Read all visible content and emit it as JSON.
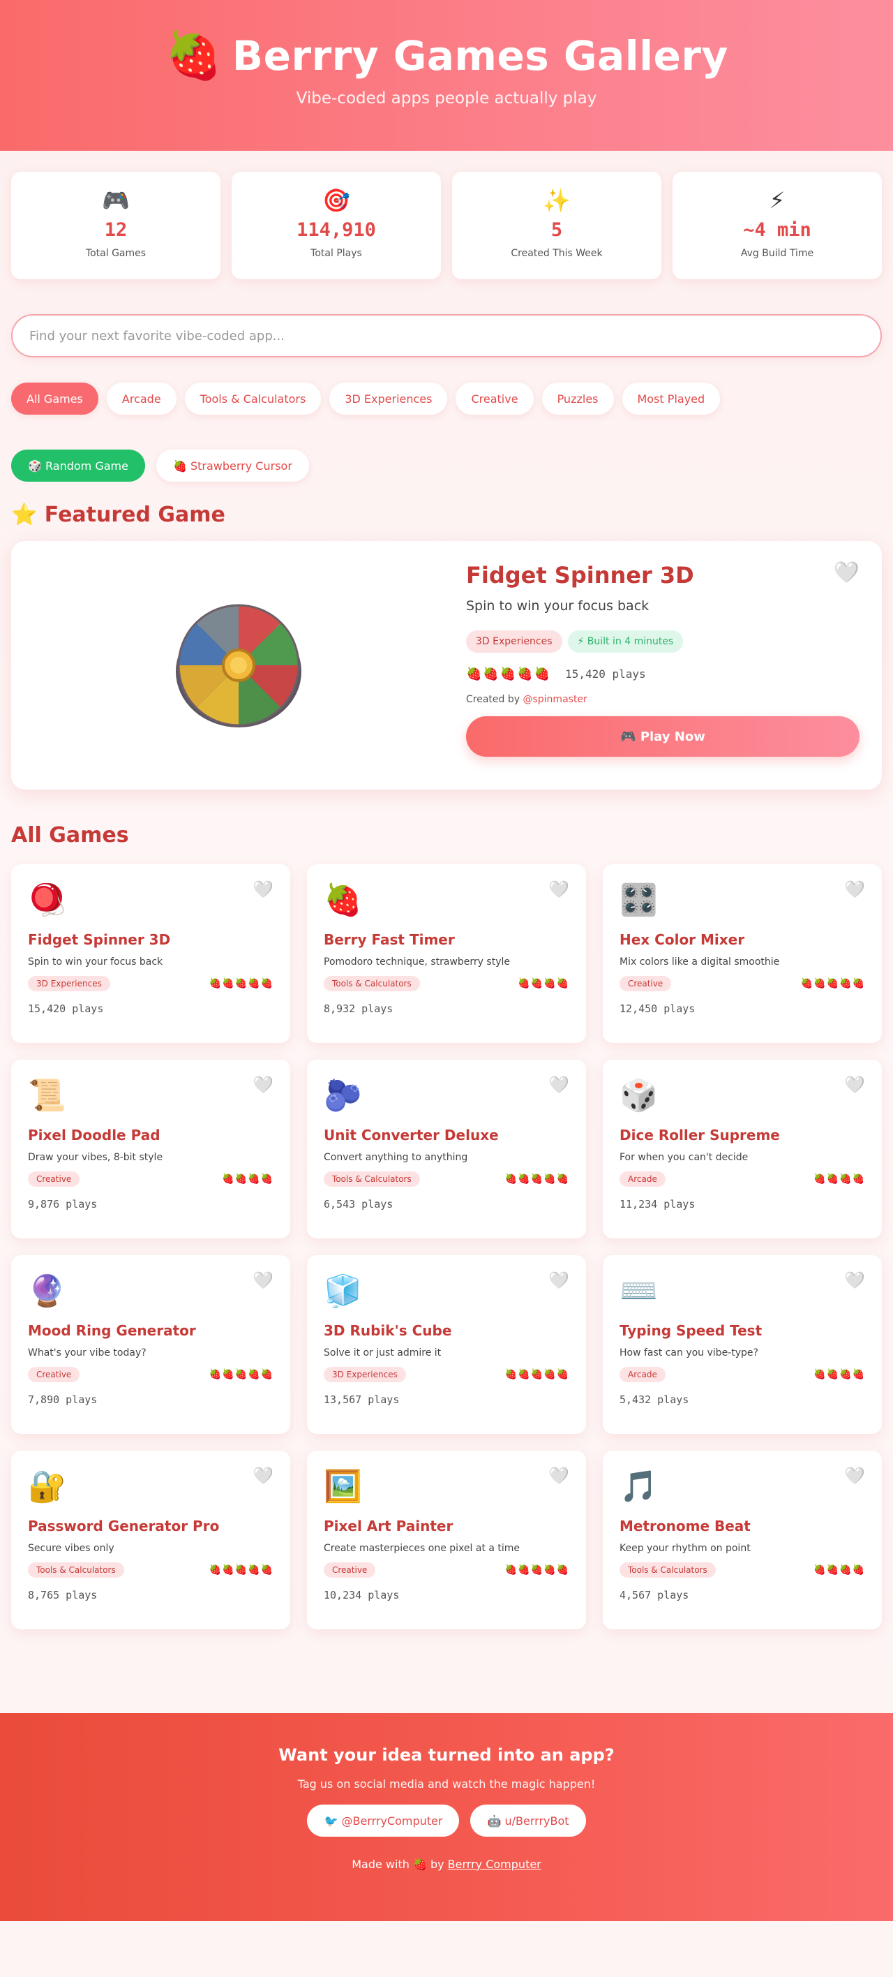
{
  "header": {
    "logo_emoji": "🍓",
    "title": "Berrry Games Gallery",
    "subtitle": "Vibe-coded apps people actually play"
  },
  "stats": [
    {
      "icon": "gamepad-icon",
      "glyph": "🎮",
      "value": "12",
      "label": "Total Games"
    },
    {
      "icon": "target-icon",
      "glyph": "🎯",
      "value": "114,910",
      "label": "Total Plays"
    },
    {
      "icon": "sparkles-icon",
      "glyph": "✨",
      "value": "5",
      "label": "Created This Week"
    },
    {
      "icon": "lightning-icon",
      "glyph": "⚡",
      "value": "~4 min",
      "label": "Avg Build Time"
    }
  ],
  "search": {
    "placeholder": "Find your next favorite vibe-coded app..."
  },
  "filters": [
    "All Games",
    "Arcade",
    "Tools & Calculators",
    "3D Experiences",
    "Creative",
    "Puzzles",
    "Most Played"
  ],
  "active_filter": "All Games",
  "actions": {
    "random_label": "🎲 Random Game",
    "cursor_label": "🍓 Strawberry Cursor"
  },
  "featured": {
    "section_title": "⭐ Featured Game",
    "title": "Fidget Spinner 3D",
    "description": "Spin to win your focus back",
    "category": "3D Experiences",
    "build_badge": "⚡ Built in 4 minutes",
    "rating_berries": "🍓🍓🍓🍓🍓",
    "plays": "15,420 plays",
    "created_prefix": "Created by ",
    "author": "@spinmaster",
    "play_label": "🎮 Play Now",
    "favorite_glyph": "🤍"
  },
  "all_games_title": "All Games",
  "games": [
    {
      "glyph": "🪀",
      "title": "Fidget Spinner 3D",
      "desc": "Spin to win your focus back",
      "tag": "3D Experiences",
      "berries": "🍓🍓🍓🍓🍓",
      "plays": "15,420 plays"
    },
    {
      "glyph": "🍓",
      "title": "Berry Fast Timer",
      "desc": "Pomodoro technique, strawberry style",
      "tag": "Tools & Calculators",
      "berries": "🍓🍓🍓🍓",
      "plays": "8,932 plays"
    },
    {
      "glyph": "🎛️",
      "title": "Hex Color Mixer",
      "desc": "Mix colors like a digital smoothie",
      "tag": "Creative",
      "berries": "🍓🍓🍓🍓🍓",
      "plays": "12,450 plays"
    },
    {
      "glyph": "📜",
      "title": "Pixel Doodle Pad",
      "desc": "Draw your vibes, 8-bit style",
      "tag": "Creative",
      "berries": "🍓🍓🍓🍓",
      "plays": "9,876 plays"
    },
    {
      "glyph": "🫐",
      "title": "Unit Converter Deluxe",
      "desc": "Convert anything to anything",
      "tag": "Tools & Calculators",
      "berries": "🍓🍓🍓🍓🍓",
      "plays": "6,543 plays"
    },
    {
      "glyph": "🎲",
      "title": "Dice Roller Supreme",
      "desc": "For when you can't decide",
      "tag": "Arcade",
      "berries": "🍓🍓🍓🍓",
      "plays": "11,234 plays"
    },
    {
      "glyph": "🔮",
      "title": "Mood Ring Generator",
      "desc": "What's your vibe today?",
      "tag": "Creative",
      "berries": "🍓🍓🍓🍓🍓",
      "plays": "7,890 plays"
    },
    {
      "glyph": "🧊",
      "title": "3D Rubik's Cube",
      "desc": "Solve it or just admire it",
      "tag": "3D Experiences",
      "berries": "🍓🍓🍓🍓🍓",
      "plays": "13,567 plays"
    },
    {
      "glyph": "⌨️",
      "title": "Typing Speed Test",
      "desc": "How fast can you vibe-type?",
      "tag": "Arcade",
      "berries": "🍓🍓🍓🍓",
      "plays": "5,432 plays"
    },
    {
      "glyph": "🔐",
      "title": "Password Generator Pro",
      "desc": "Secure vibes only",
      "tag": "Tools & Calculators",
      "berries": "🍓🍓🍓🍓🍓",
      "plays": "8,765 plays"
    },
    {
      "glyph": "🖼️",
      "title": "Pixel Art Painter",
      "desc": "Create masterpieces one pixel at a time",
      "tag": "Creative",
      "berries": "🍓🍓🍓🍓🍓",
      "plays": "10,234 plays"
    },
    {
      "glyph": "🎵",
      "title": "Metronome Beat",
      "desc": "Keep your rhythm on point",
      "tag": "Tools & Calculators",
      "berries": "🍓🍓🍓🍓",
      "plays": "4,567 plays"
    }
  ],
  "footer": {
    "title": "Want your idea turned into an app?",
    "tagline": "Tag us on social media and watch the magic happen!",
    "twitter_label": "🐦 @BerrryComputer",
    "reddit_label": "🤖 u/BerrryBot",
    "made_prefix": "Made with 🍓 by ",
    "made_link": "Berrry Computer"
  },
  "colors": {
    "accent": "#f86a6f",
    "title_red": "#c53a36",
    "green": "#22c069"
  }
}
